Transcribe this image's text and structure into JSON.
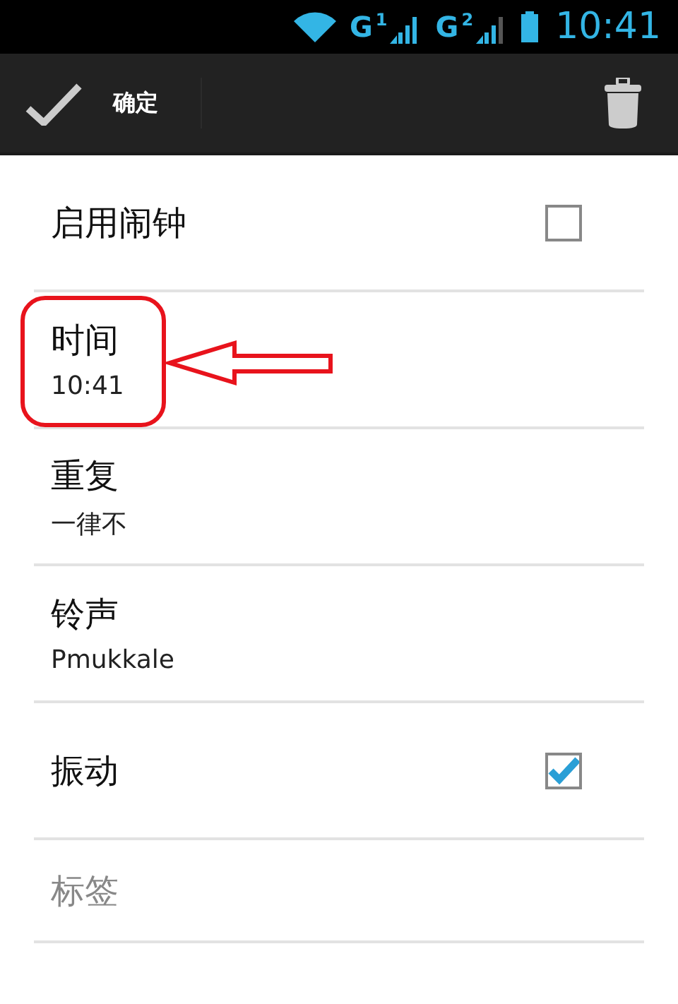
{
  "status_bar": {
    "sims": [
      {
        "network": "G",
        "slot": "1"
      },
      {
        "network": "G",
        "slot": "2"
      }
    ],
    "time": "10:41"
  },
  "action_bar": {
    "confirm_label": "确定"
  },
  "items": [
    {
      "kind": "checkbox",
      "title": "启用闹钟",
      "checked": false,
      "annotated": false
    },
    {
      "kind": "detail",
      "title": "时间",
      "summary": "10:41",
      "annotated": true
    },
    {
      "kind": "detail",
      "title": "重复",
      "summary": "一律不",
      "annotated": false
    },
    {
      "kind": "detail",
      "title": "铃声",
      "summary": "Pmukkale",
      "annotated": false
    },
    {
      "kind": "checkbox",
      "title": "振动",
      "checked": true,
      "annotated": false
    },
    {
      "kind": "field",
      "placeholder": "标签",
      "annotated": false
    }
  ]
}
